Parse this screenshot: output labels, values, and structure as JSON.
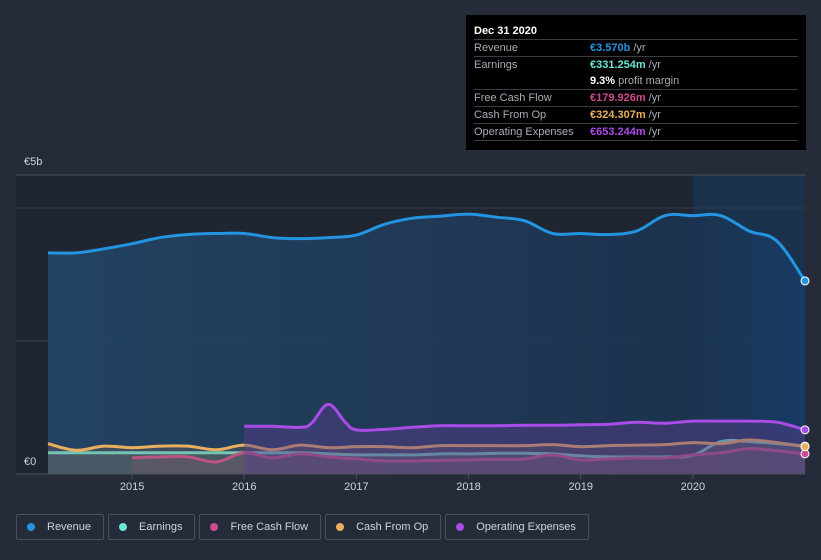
{
  "tooltip": {
    "date": "Dec 31 2020",
    "rows": [
      {
        "label": "Revenue",
        "value": "€3.570b",
        "unit": "/yr",
        "color": "#2394df"
      },
      {
        "label": "Earnings",
        "value": "€331.254m",
        "unit": "/yr",
        "color": "#6ce5d3"
      },
      {
        "label": "",
        "value": "9.3%",
        "unit": "profit margin",
        "color": "#ffffff"
      },
      {
        "label": "Free Cash Flow",
        "value": "€179.926m",
        "unit": "/yr",
        "color": "#d04b8e"
      },
      {
        "label": "Cash From Op",
        "value": "€324.307m",
        "unit": "/yr",
        "color": "#e9af5f"
      },
      {
        "label": "Operating Expenses",
        "value": "€653.244m",
        "unit": "/yr",
        "color": "#a94ce8"
      }
    ]
  },
  "legend": [
    {
      "label": "Revenue",
      "color": "#2394df"
    },
    {
      "label": "Earnings",
      "color": "#6ce5d3"
    },
    {
      "label": "Free Cash Flow",
      "color": "#d04b8e"
    },
    {
      "label": "Cash From Op",
      "color": "#e9af5f"
    },
    {
      "label": "Operating Expenses",
      "color": "#a94ce8"
    }
  ],
  "chart_data": {
    "type": "area",
    "title": "",
    "xlabel": "",
    "ylabel": "",
    "currency": "EUR",
    "ylim": [
      0,
      5
    ],
    "y_unit": "€b",
    "y_tick_labels": [
      "€0",
      "€5b"
    ],
    "xlim": [
      2014.25,
      2021.0
    ],
    "x_tick_labels": [
      "2015",
      "2016",
      "2017",
      "2018",
      "2019",
      "2020"
    ],
    "x_ticks": [
      2015,
      2016,
      2017,
      2018,
      2019,
      2020
    ],
    "highlight_start": 2020.0,
    "grid": true,
    "legend_position": "bottom",
    "series": [
      {
        "name": "Revenue",
        "color": "#2394df",
        "x": [
          2014.25,
          2014.5,
          2014.75,
          2015.0,
          2015.25,
          2015.5,
          2015.75,
          2016.0,
          2016.25,
          2016.5,
          2016.75,
          2017.0,
          2017.25,
          2017.5,
          2017.75,
          2018.0,
          2018.25,
          2018.5,
          2018.75,
          2019.0,
          2019.25,
          2019.5,
          2019.75,
          2020.0,
          2020.25,
          2020.5,
          2020.75,
          2021.0
        ],
        "values": [
          4.12,
          4.12,
          4.2,
          4.3,
          4.42,
          4.48,
          4.5,
          4.5,
          4.42,
          4.4,
          4.42,
          4.47,
          4.68,
          4.8,
          4.84,
          4.88,
          4.82,
          4.75,
          4.5,
          4.5,
          4.48,
          4.55,
          4.85,
          4.85,
          4.85,
          4.55,
          4.35,
          3.57
        ]
      },
      {
        "name": "Earnings",
        "color": "#6ce5d3",
        "x": [
          2014.25,
          2014.5,
          2014.75,
          2015.0,
          2015.25,
          2015.5,
          2015.75,
          2016.0,
          2016.25,
          2016.5,
          2016.75,
          2017.0,
          2017.25,
          2017.5,
          2017.75,
          2018.0,
          2018.25,
          2018.5,
          2018.75,
          2019.0,
          2019.25,
          2019.5,
          2019.75,
          2020.0,
          2020.25,
          2020.5,
          2020.75,
          2021.0
        ],
        "values": [
          0.2,
          0.2,
          0.2,
          0.2,
          0.2,
          0.2,
          0.2,
          0.2,
          0.2,
          0.2,
          0.18,
          0.16,
          0.16,
          0.16,
          0.18,
          0.18,
          0.19,
          0.19,
          0.18,
          0.14,
          0.12,
          0.12,
          0.12,
          0.15,
          0.42,
          0.42,
          0.38,
          0.33
        ]
      },
      {
        "name": "Free Cash Flow",
        "color": "#d04b8e",
        "x": [
          2015.0,
          2015.25,
          2015.5,
          2015.75,
          2016.0,
          2016.25,
          2016.5,
          2016.75,
          2017.0,
          2017.25,
          2017.5,
          2017.75,
          2018.0,
          2018.25,
          2018.5,
          2018.75,
          2019.0,
          2019.25,
          2019.5,
          2019.75,
          2020.0,
          2020.25,
          2020.5,
          2020.75,
          2021.0
        ],
        "values": [
          0.1,
          0.12,
          0.12,
          0.02,
          0.2,
          0.1,
          0.18,
          0.12,
          0.08,
          0.04,
          0.04,
          0.05,
          0.06,
          0.07,
          0.08,
          0.16,
          0.06,
          0.08,
          0.1,
          0.1,
          0.16,
          0.2,
          0.28,
          0.24,
          0.18
        ]
      },
      {
        "name": "Cash From Op",
        "color": "#e9af5f",
        "x": [
          2014.25,
          2014.5,
          2014.75,
          2015.0,
          2015.25,
          2015.5,
          2015.75,
          2016.0,
          2016.25,
          2016.5,
          2016.75,
          2017.0,
          2017.25,
          2017.5,
          2017.75,
          2018.0,
          2018.25,
          2018.5,
          2018.75,
          2019.0,
          2019.25,
          2019.5,
          2019.75,
          2020.0,
          2020.25,
          2020.5,
          2020.75,
          2021.0
        ],
        "values": [
          0.38,
          0.25,
          0.33,
          0.3,
          0.33,
          0.33,
          0.26,
          0.35,
          0.26,
          0.35,
          0.3,
          0.32,
          0.32,
          0.3,
          0.34,
          0.34,
          0.34,
          0.34,
          0.36,
          0.32,
          0.34,
          0.35,
          0.36,
          0.4,
          0.38,
          0.45,
          0.4,
          0.32
        ]
      },
      {
        "name": "Operating Expenses",
        "color": "#a94ce8",
        "x": [
          2016.0,
          2016.25,
          2016.5,
          2016.6,
          2016.75,
          2016.9,
          2017.0,
          2017.25,
          2017.5,
          2017.75,
          2018.0,
          2018.25,
          2018.5,
          2018.75,
          2019.0,
          2019.25,
          2019.5,
          2019.75,
          2020.0,
          2020.25,
          2020.5,
          2020.75,
          2021.0
        ],
        "values": [
          0.72,
          0.72,
          0.7,
          0.78,
          1.15,
          0.8,
          0.65,
          0.66,
          0.7,
          0.73,
          0.73,
          0.73,
          0.74,
          0.74,
          0.75,
          0.76,
          0.8,
          0.78,
          0.82,
          0.82,
          0.82,
          0.8,
          0.65
        ]
      }
    ]
  }
}
